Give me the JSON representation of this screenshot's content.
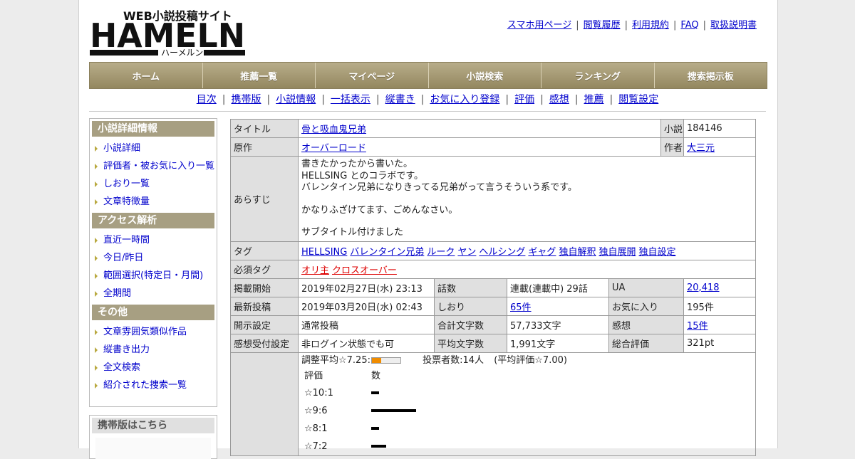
{
  "header": {
    "logo_text": "HAMELN",
    "logo_tagline": "WEB小説投稿サイト",
    "logo_kana": "ハーメルン",
    "top_links": [
      "スマホ用ページ",
      "閲覧履歴",
      "利用規約",
      "FAQ",
      "取扱説明書"
    ]
  },
  "main_nav": [
    "ホーム",
    "推薦一覧",
    "マイページ",
    "小説検索",
    "ランキング",
    "捜索掲示板"
  ],
  "sub_nav": [
    "目次",
    "携帯版",
    "小説情報",
    "一括表示",
    "縦書き",
    "お気に入り登録",
    "評価",
    "感想",
    "推薦",
    "閲覧設定"
  ],
  "sidebar": {
    "sections": [
      {
        "title": "小説詳細情報",
        "items": [
          "小説詳細",
          "評価者・被お気に入り一覧",
          "しおり一覧",
          "文章特徴量"
        ]
      },
      {
        "title": "アクセス解析",
        "items": [
          "直近一時間",
          "今日/昨日",
          "範囲選択(特定日・月間)",
          "全期間"
        ]
      },
      {
        "title": "その他",
        "items": [
          "文章雰囲気類似作品",
          "縦書き出力",
          "全文検索",
          "紹介された捜索一覧"
        ]
      }
    ],
    "mobile_title": "携帯版はこちら"
  },
  "info": {
    "title_label": "タイトル",
    "title": "骨と吸血鬼兄弟",
    "id_label": "小説ID",
    "id": "184146",
    "original_label": "原作",
    "original": "オーバーロード",
    "author_label": "作者",
    "author": "大三元",
    "synopsis_label": "あらすじ",
    "synopsis": [
      "書きたかったから書いた。",
      "HELLSING とのコラボです。",
      "バレンタイン兄弟になりきってる兄弟がって言うそういう系です。",
      "",
      "かなりふざけてます、ごめんなさい。",
      "",
      "サブタイトル付けました"
    ],
    "tag_label": "タグ",
    "tags": [
      "HELLSING",
      "バレンタイン兄弟",
      "ルーク",
      "ヤン",
      "ヘルシング",
      "ギャグ",
      "独自解釈",
      "独自展開",
      "独自設定"
    ],
    "required_tag_label": "必須タグ",
    "required_tags": [
      "オリ主",
      "クロスオーバー"
    ],
    "start_label": "掲載開始",
    "start": "2019年02月27日(水) 23:13",
    "episodes_label": "話数",
    "episodes": "連載(連載中) 29話",
    "ua_label": "UA",
    "ua": "20,418",
    "latest_label": "最新投稿",
    "latest": "2019年03月20日(水) 02:43",
    "bookmark_label": "しおり",
    "bookmark": "65件",
    "favorite_label": "お気に入り",
    "favorite": "195件",
    "disclosure_label": "開示設定",
    "disclosure": "通常投稿",
    "total_chars_label": "合計文字数",
    "total_chars": "57,733文字",
    "comments_label": "感想",
    "comments": "15件",
    "comment_accept_label": "感想受付設定",
    "comment_accept": "非ログイン状態でも可",
    "avg_chars_label": "平均文字数",
    "avg_chars": "1,991文字",
    "total_eval_label": "総合評価",
    "total_eval": "321pt"
  },
  "rating": {
    "adjusted_label": "調整平均☆7.25:",
    "adjusted_value": 7.25,
    "voters": "投票者数:14人",
    "average": "(平均評価☆7.00)",
    "col_rating": "評価",
    "col_count": "数",
    "rows": [
      {
        "label": "☆10:1",
        "count": 1
      },
      {
        "label": "☆9:6",
        "count": 6
      },
      {
        "label": "☆8:1",
        "count": 1
      },
      {
        "label": "☆7:2",
        "count": 2
      }
    ]
  }
}
